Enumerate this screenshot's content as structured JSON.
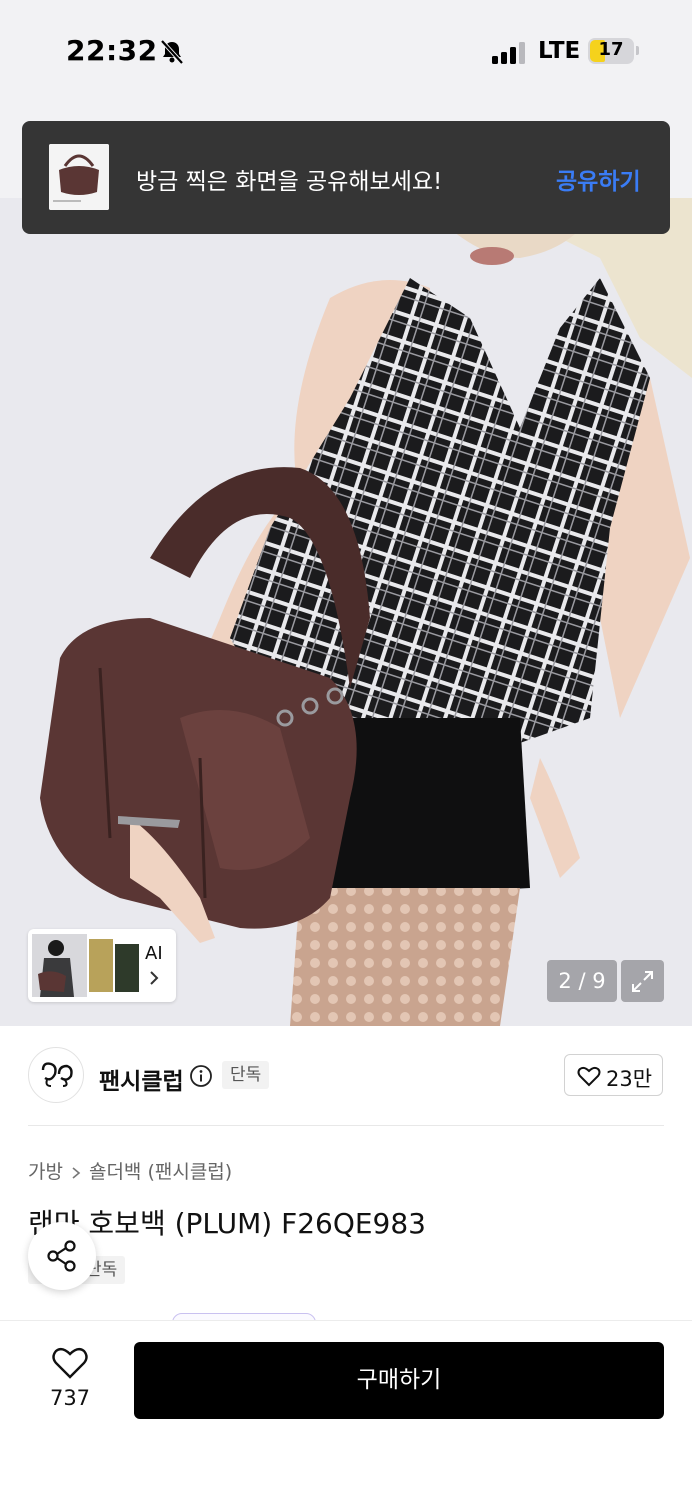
{
  "status_bar": {
    "time": "22:32",
    "network": "LTE",
    "battery": "17",
    "icons": [
      "bell-off-icon",
      "cellular-signal-icon",
      "battery-icon"
    ]
  },
  "toast": {
    "message": "방금 찍은 화면을 공유해보세요!",
    "action_label": "공유하기",
    "action_color": "#3a7cf5"
  },
  "gallery": {
    "ai_label": "AI",
    "page_indicator": "2 / 9",
    "icons": [
      "chevron-right-icon",
      "expand-icon"
    ]
  },
  "brand": {
    "name": "팬시클럽",
    "badge": "단독",
    "likes": "23만",
    "icons": [
      "brand-logo-icon",
      "info-icon",
      "heart-icon"
    ]
  },
  "product": {
    "breadcrumb": [
      "가방",
      "숄더백 (팬시클럽)"
    ],
    "title": "랜마 호보백 (PLUM) F26QE983",
    "badge": "단독"
  },
  "bottom_bar": {
    "wish_count": "737",
    "buy_label": "구매하기",
    "icons": [
      "heart-icon",
      "share-icon"
    ]
  },
  "colors": {
    "accent": "#3a7cf5",
    "buy_button": "#000000",
    "toast_bg": "#353535",
    "bag": "#5a3634"
  }
}
